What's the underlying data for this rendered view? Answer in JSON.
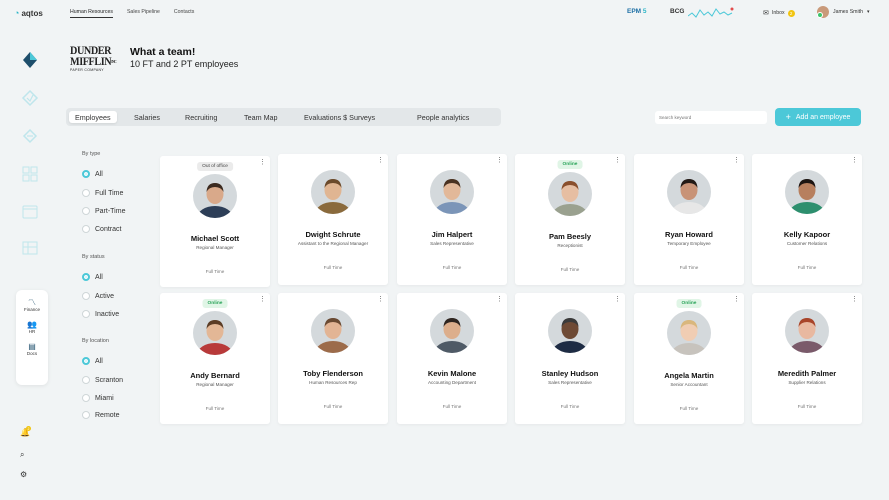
{
  "app": {
    "logo": "aqtos"
  },
  "topnav": [
    "Human Resources",
    "Sales Pipeline",
    "Contacts"
  ],
  "metrics": {
    "epm": "EPM",
    "epm_suffix": "5",
    "bcg": "BCG"
  },
  "inbox": {
    "label": "Inbox",
    "count": "2"
  },
  "user": {
    "name": "James Smith"
  },
  "company": {
    "name_line1": "DUNDER",
    "name_line2": "MIFFLIN",
    "name_suffix": "INC",
    "tagline": "PAPER COMPANY"
  },
  "header": {
    "title": "What a team!",
    "subtitle": "10 FT and 2 PT employees"
  },
  "tabs": [
    "Employees",
    "Salaries",
    "Recruiting",
    "Team Map",
    "Evaluations $ Surveys",
    "People analytics"
  ],
  "search": {
    "placeholder": "Search keyword"
  },
  "add_button": "Add an employee",
  "sidebar": {
    "items": [
      "Finance",
      "HR",
      "Docs"
    ],
    "notif_count": "2"
  },
  "filters": {
    "type": {
      "label": "By type",
      "options": [
        "All",
        "Full Time",
        "Part-Time",
        "Contract"
      ],
      "selected": "All"
    },
    "status": {
      "label": "By status",
      "options": [
        "All",
        "Active",
        "Inactive"
      ],
      "selected": "All"
    },
    "location": {
      "label": "By location",
      "options": [
        "All",
        "Scranton",
        "Miami",
        "Remote"
      ],
      "selected": "All"
    }
  },
  "employees": [
    {
      "name": "Michael Scott",
      "role": "Regional Manager",
      "type": "Full Time",
      "tag": "Out of office",
      "tag_kind": "out",
      "skin": "#d9a98a",
      "hair": "#3b2a20",
      "shirt": "#2d3e57"
    },
    {
      "name": "Dwight Schrute",
      "role": "Assistant to the Regional Manager",
      "type": "Full Time",
      "tag": "",
      "tag_kind": "",
      "skin": "#e0b592",
      "hair": "#6b4a2b",
      "shirt": "#8a6a3c"
    },
    {
      "name": "Jim Halpert",
      "role": "Sales Representative",
      "type": "Full Time",
      "tag": "",
      "tag_kind": "",
      "skin": "#e2b899",
      "hair": "#4a3221",
      "shirt": "#7b95b8"
    },
    {
      "name": "Pam Beesly",
      "role": "Receptionist",
      "type": "Full Time",
      "tag": "Online",
      "tag_kind": "online",
      "skin": "#e6bea2",
      "hair": "#8a4f2c",
      "shirt": "#9aa18f"
    },
    {
      "name": "Ryan Howard",
      "role": "Temporary Employee",
      "type": "Full Time",
      "tag": "",
      "tag_kind": "",
      "skin": "#c89377",
      "hair": "#231a16",
      "shirt": "#e7e7e7"
    },
    {
      "name": "Kelly Kapoor",
      "role": "Customer Relations",
      "type": "Full Time",
      "tag": "",
      "tag_kind": "",
      "skin": "#b77f5e",
      "hair": "#1d1512",
      "shirt": "#2d8f6e"
    },
    {
      "name": "Andy Bernard",
      "role": "Regional Manager",
      "type": "Full Time",
      "tag": "Online",
      "tag_kind": "online",
      "skin": "#e3b796",
      "hair": "#5b3c25",
      "shirt": "#b83a3a"
    },
    {
      "name": "Toby Flenderson",
      "role": "Human Resources Rep",
      "type": "Full Time",
      "tag": "",
      "tag_kind": "",
      "skin": "#e2b494",
      "hair": "#6a4a32",
      "shirt": "#9c6b4a"
    },
    {
      "name": "Kevin Malone",
      "role": "Accounting Department",
      "type": "Full Time",
      "tag": "",
      "tag_kind": "",
      "skin": "#dcae8c",
      "hair": "#2e2520",
      "shirt": "#4f5a66"
    },
    {
      "name": "Stanley Hudson",
      "role": "Sales Representative",
      "type": "Full Time",
      "tag": "",
      "tag_kind": "",
      "skin": "#6e4a35",
      "hair": "#3a3a3a",
      "shirt": "#1e2c44"
    },
    {
      "name": "Angela Martin",
      "role": "Senior Accountant",
      "type": "Full Time",
      "tag": "Online",
      "tag_kind": "online",
      "skin": "#f0cdb3",
      "hair": "#d9b77d",
      "shirt": "#c7c3bd"
    },
    {
      "name": "Meredith Palmer",
      "role": "Supplier Relations",
      "type": "Full Time",
      "tag": "",
      "tag_kind": "",
      "skin": "#e8b8a0",
      "hair": "#a8452a",
      "shirt": "#7a5a6a"
    }
  ]
}
